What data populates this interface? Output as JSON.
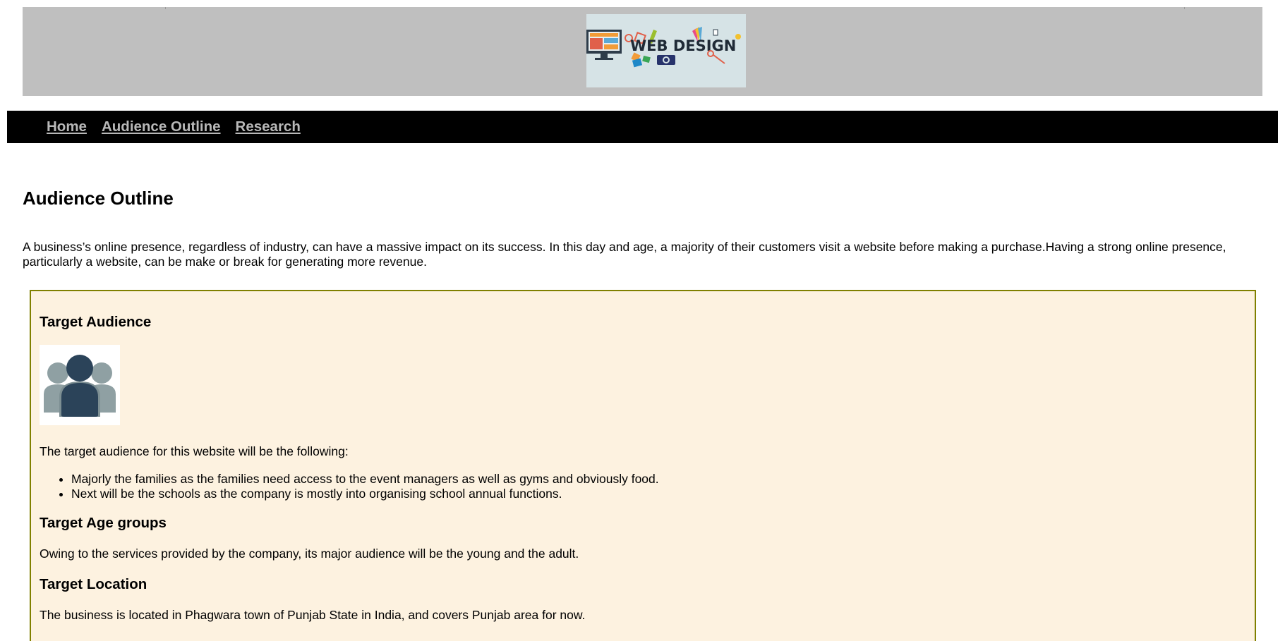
{
  "header": {
    "logo_text": "WEB DESIGN",
    "logo_alt": "Web Design banner logo"
  },
  "nav": {
    "items": [
      {
        "label": "Home"
      },
      {
        "label": "Audience Outline"
      },
      {
        "label": "Research"
      }
    ]
  },
  "main": {
    "title": "Audience Outline",
    "intro": "A business’s online presence, regardless of industry, can have a massive impact on its success. In this day and age, a majority of their customers visit a website before making a purchase.Having a strong online presence, particularly a website, can be make or break for generating more revenue.",
    "sections": {
      "target_audience": {
        "heading": "Target Audience",
        "image_alt": "group of people icon",
        "lead": "The target audience for this website will be the following:",
        "bullets": [
          "Majorly the families as the families need access to the event managers as well as gyms and obviously food.",
          "Next will be the schools as the company is mostly into organising school annual functions."
        ]
      },
      "target_age": {
        "heading": "Target Age groups",
        "text": "Owing to the services provided by the company, its major audience will be the young and the adult."
      },
      "target_location": {
        "heading": "Target Location",
        "text": "The business is located in Phagwara town of Punjab State in India, and covers Punjab area for now."
      }
    }
  },
  "colors": {
    "banner_bg": "#bfbfbf",
    "nav_bg": "#000000",
    "nav_link": "#b8b8b8",
    "box_bg": "#fdf2e0",
    "box_border": "#808000",
    "icon_dark": "#2b4359",
    "icon_light": "#8fa0a3"
  }
}
